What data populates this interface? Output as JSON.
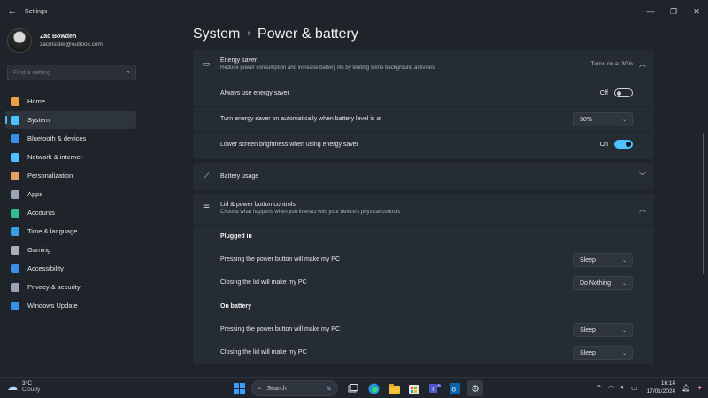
{
  "window": {
    "title": "Settings",
    "back_glyph": "←"
  },
  "profile": {
    "name": "Zac Bowden",
    "email": "zacinsider@outlook.com"
  },
  "search": {
    "placeholder": "Find a setting"
  },
  "sidebar": {
    "items": [
      {
        "label": "Home",
        "icon": "home-icon",
        "color": "#f0a040"
      },
      {
        "label": "System",
        "icon": "system-icon",
        "color": "#4cc2ff"
      },
      {
        "label": "Bluetooth & devices",
        "icon": "bluetooth-icon",
        "color": "#3a8ee6"
      },
      {
        "label": "Network & internet",
        "icon": "wifi-icon",
        "color": "#4cc2ff"
      },
      {
        "label": "Personalization",
        "icon": "brush-icon",
        "color": "#e8a060"
      },
      {
        "label": "Apps",
        "icon": "apps-icon",
        "color": "#9aa4b8"
      },
      {
        "label": "Accounts",
        "icon": "accounts-icon",
        "color": "#2fbf8f"
      },
      {
        "label": "Time & language",
        "icon": "clock-globe-icon",
        "color": "#3a9ee6"
      },
      {
        "label": "Gaming",
        "icon": "gaming-icon",
        "color": "#aab0b8"
      },
      {
        "label": "Accessibility",
        "icon": "accessibility-icon",
        "color": "#3a8ee6"
      },
      {
        "label": "Privacy & security",
        "icon": "shield-icon",
        "color": "#9aa4b8"
      },
      {
        "label": "Windows Update",
        "icon": "update-icon",
        "color": "#3a8ee6"
      }
    ]
  },
  "breadcrumb": {
    "parent": "System",
    "current": "Power & battery"
  },
  "energy_saver": {
    "title": "Energy saver",
    "description": "Reduce power consumption and increase battery life by limiting some background activities",
    "status": "Turns on at 30%",
    "always_label": "Always use energy saver",
    "always_state": "Off",
    "auto_label": "Turn energy saver on automatically when battery level is at",
    "auto_value": "30%",
    "brightness_label": "Lower screen brightness when using energy saver",
    "brightness_state": "On"
  },
  "battery_usage": {
    "title": "Battery usage"
  },
  "lid_power": {
    "title": "Lid & power button controls",
    "description": "Choose what happens when you interact with your device's physical controls",
    "plugged_in": {
      "heading": "Plugged in",
      "power_label": "Pressing the power button will make my PC",
      "power_value": "Sleep",
      "lid_label": "Closing the lid will make my PC",
      "lid_value": "Do Nothing"
    },
    "on_battery": {
      "heading": "On battery",
      "power_label": "Pressing the power button will make my PC",
      "power_value": "Sleep",
      "lid_label": "Closing the lid will make my PC",
      "lid_value": "Sleep"
    }
  },
  "taskbar": {
    "weather_temp": "3°C",
    "weather_desc": "Cloudy",
    "search_label": "Search",
    "time": "16:14",
    "date": "17/01/2024"
  }
}
